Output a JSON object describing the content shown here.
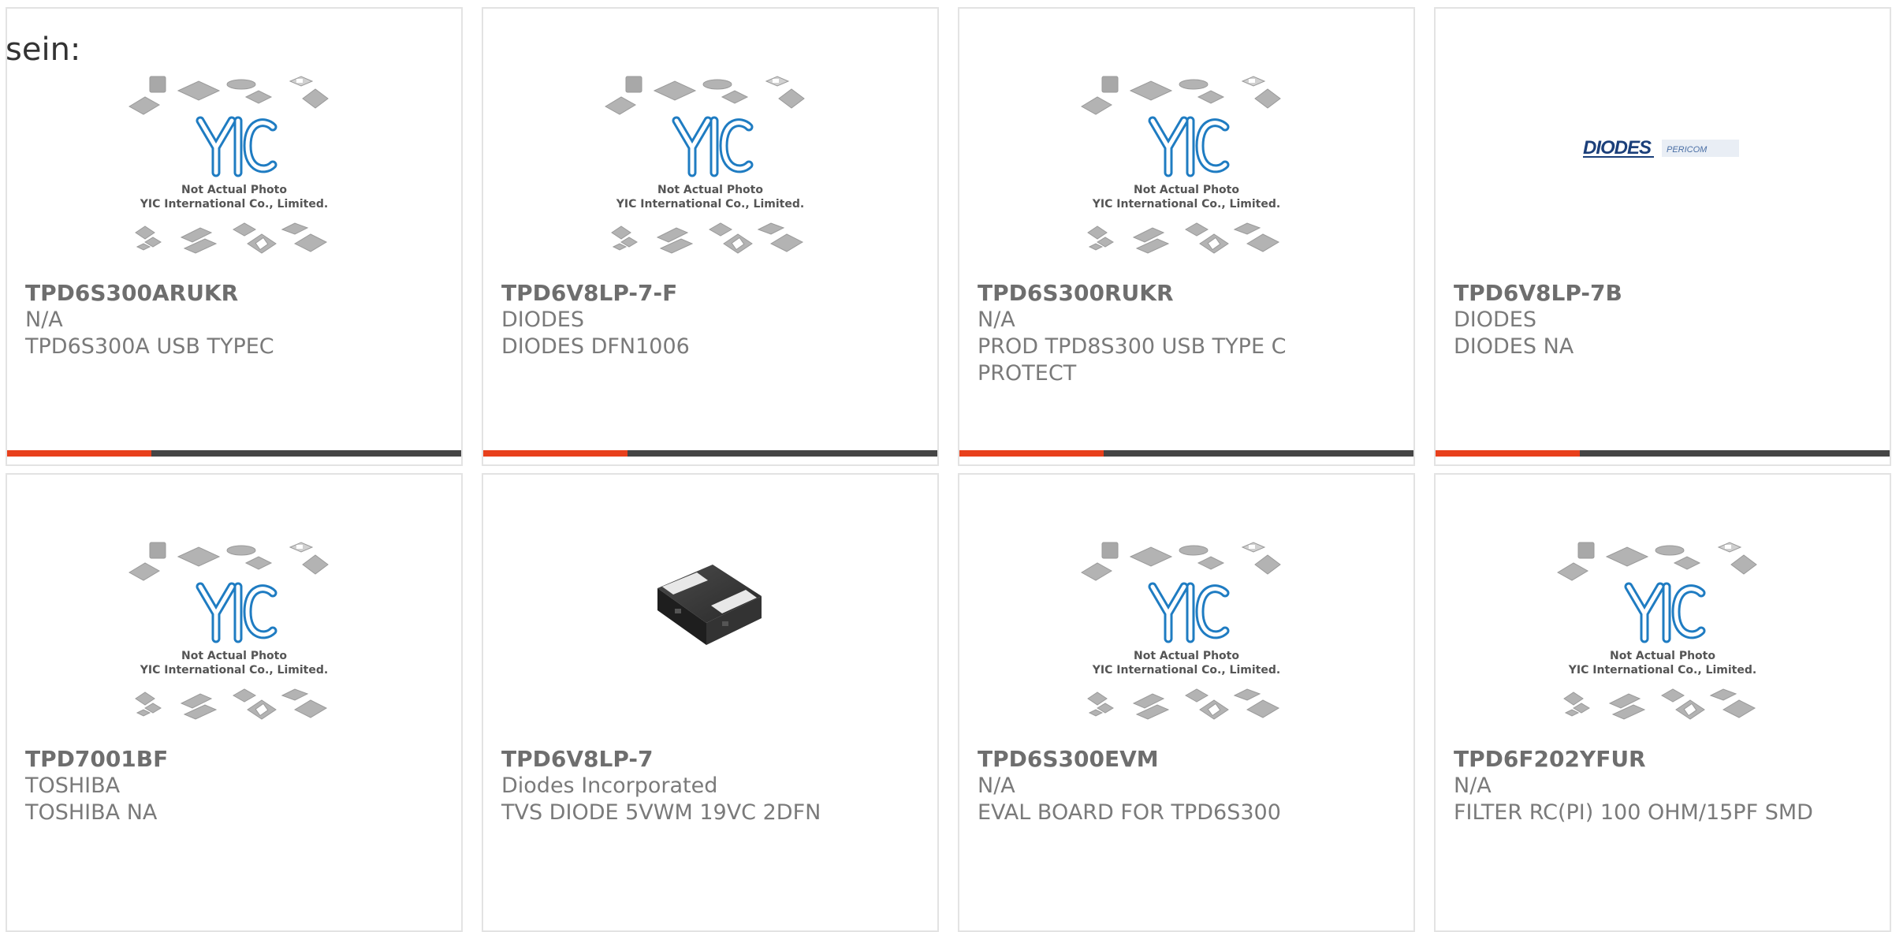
{
  "intro_text": "sein:",
  "placeholder": {
    "logo_text": "YIC",
    "line1": "Not Actual Photo",
    "line2": "YIC International Co., Limited."
  },
  "diodes_logo": {
    "brand": "DIODES",
    "sub_brand": "PERICOM"
  },
  "colors": {
    "accent_bar": "#e8401c",
    "bar_dark": "#454545",
    "logo_blue": "#1e7fc1",
    "diodes_navy": "#1b3f7a"
  },
  "products": [
    {
      "part": "TPD6S300ARUKR",
      "manufacturer": "N/A",
      "description": "TPD6S300A USB TYPEC",
      "image": "placeholder",
      "has_bar": true
    },
    {
      "part": "TPD6V8LP-7-F",
      "manufacturer": "DIODES",
      "description": "DIODES DFN1006",
      "image": "placeholder",
      "has_bar": true
    },
    {
      "part": "TPD6S300RUKR",
      "manufacturer": "N/A",
      "description": "PROD TPD8S300 USB TYPE C PROTECT",
      "image": "placeholder",
      "has_bar": true
    },
    {
      "part": "TPD6V8LP-7B",
      "manufacturer": "DIODES",
      "description": "DIODES NA",
      "image": "diodes-logo",
      "has_bar": true
    },
    {
      "part": "TPD7001BF",
      "manufacturer": "TOSHIBA",
      "description": "TOSHIBA NA",
      "image": "placeholder",
      "has_bar": false
    },
    {
      "part": "TPD6V8LP-7",
      "manufacturer": "Diodes Incorporated",
      "description": "TVS DIODE 5VWM 19VC 2DFN",
      "image": "chip-photo",
      "has_bar": false
    },
    {
      "part": "TPD6S300EVM",
      "manufacturer": "N/A",
      "description": "EVAL BOARD FOR TPD6S300",
      "image": "placeholder",
      "has_bar": false
    },
    {
      "part": "TPD6F202YFUR",
      "manufacturer": "N/A",
      "description": "FILTER RC(PI) 100 OHM/15PF SMD",
      "image": "placeholder",
      "has_bar": false
    }
  ]
}
